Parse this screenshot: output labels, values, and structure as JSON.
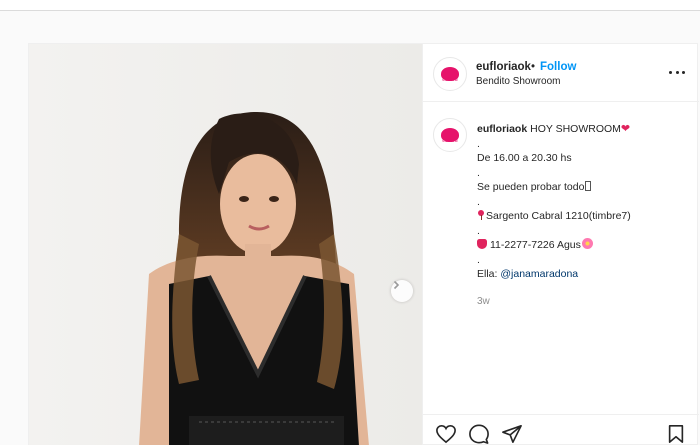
{
  "post": {
    "username": "eufloriaok",
    "dot": "•",
    "follow_label": "Follow",
    "location": "Bendito Showroom",
    "avatar_brand": "euflora",
    "caption": {
      "username": "eufloriaok",
      "title": "HOY SHOWROOM",
      "dot1": ".",
      "schedule": "De 16.00 a 20.30 hs",
      "dot2": ".",
      "try_on": "Se pueden probar todo",
      "dot3": ".",
      "address": "Sargento Cabral 1210(timbre7)",
      "dot4": ".",
      "phone": "11-2277-7226 Agus",
      "dot5": ".",
      "model_label": "Ella:",
      "mention": "@janamaradona"
    },
    "time_ago": "3w"
  },
  "icons": {
    "more": "more-options-icon",
    "next": "chevron-right-icon",
    "like": "heart-icon",
    "comment": "comment-icon",
    "share": "paper-plane-icon",
    "save": "bookmark-icon"
  },
  "colors": {
    "accent": "#0095f6",
    "brand": "#e6136b",
    "heart": "#e0245e"
  }
}
